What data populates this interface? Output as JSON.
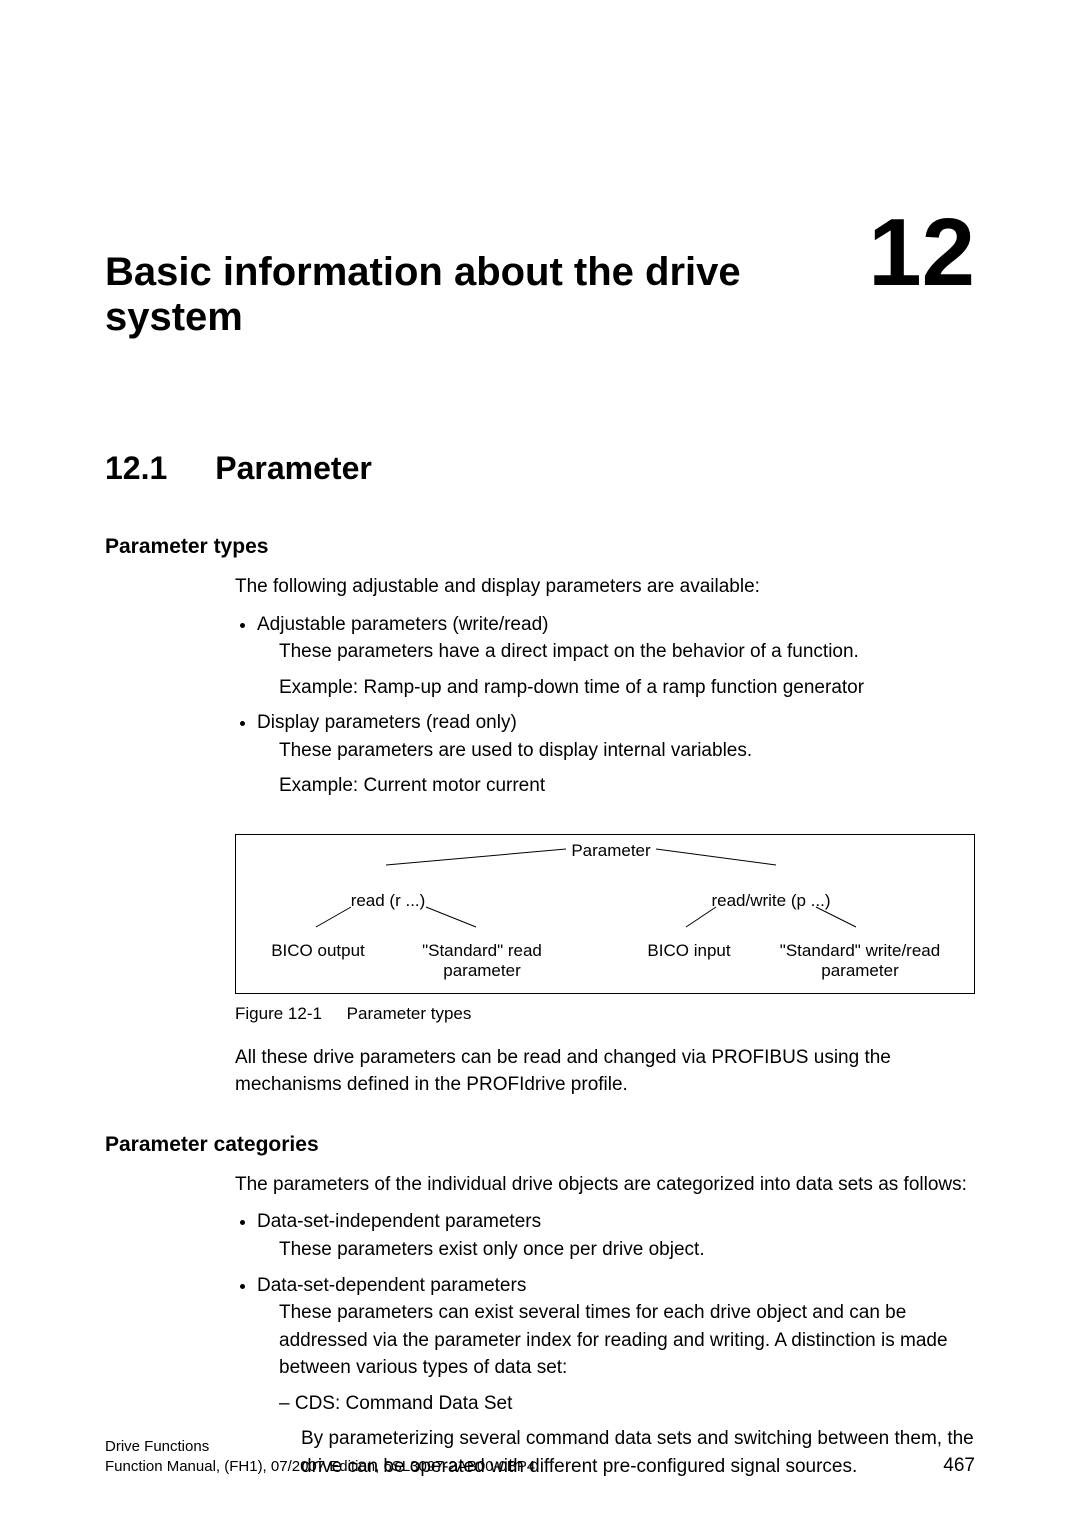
{
  "chapter": {
    "title": "Basic information about the drive system",
    "number": "12"
  },
  "section": {
    "number": "12.1",
    "title": "Parameter"
  },
  "paramTypes": {
    "heading": "Parameter types",
    "intro": "The following adjustable and display parameters are available:",
    "bullets": [
      {
        "title": "Adjustable parameters (write/read)",
        "line1": "These parameters have a direct impact on the behavior of a function.",
        "line2": "Example: Ramp-up and ramp-down time of a ramp function generator"
      },
      {
        "title": "Display parameters (read only)",
        "line1": "These parameters are used to display internal variables.",
        "line2": "Example: Current motor current"
      }
    ]
  },
  "diagram": {
    "parameter": "Parameter",
    "read": "read (r ...)",
    "readwrite": "read/write (p ...)",
    "bico_output": "BICO output",
    "std_read": "\"Standard\" read\nparameter",
    "bico_input": "BICO input",
    "std_write_read": "\"Standard\" write/read\nparameter"
  },
  "figure": {
    "num": "Figure 12-1",
    "caption": "Parameter types"
  },
  "afterFigure": "All these drive parameters can be read and changed via PROFIBUS using the mechanisms defined in the PROFIdrive profile.",
  "paramCategories": {
    "heading": "Parameter categories",
    "intro": "The parameters of the individual drive objects are categorized into data sets as follows:",
    "bullets": [
      {
        "title": "Data-set-independent parameters",
        "line1": "These parameters exist only once per drive object."
      },
      {
        "title": "Data-set-dependent parameters",
        "line1": "These parameters can exist several times for each drive object and can be addressed via the parameter index for reading and writing. A distinction is made between various types of data set:",
        "dash": {
          "label": "CDS: Command Data Set",
          "desc": "By parameterizing several command data sets and switching between them, the drive can be operated with different pre-configured signal sources."
        }
      }
    ]
  },
  "footer": {
    "line1": "Drive Functions",
    "line2": "Function Manual, (FH1), 07/2007 Edition, 6SL3097-2AB00-0BP4",
    "page": "467"
  }
}
